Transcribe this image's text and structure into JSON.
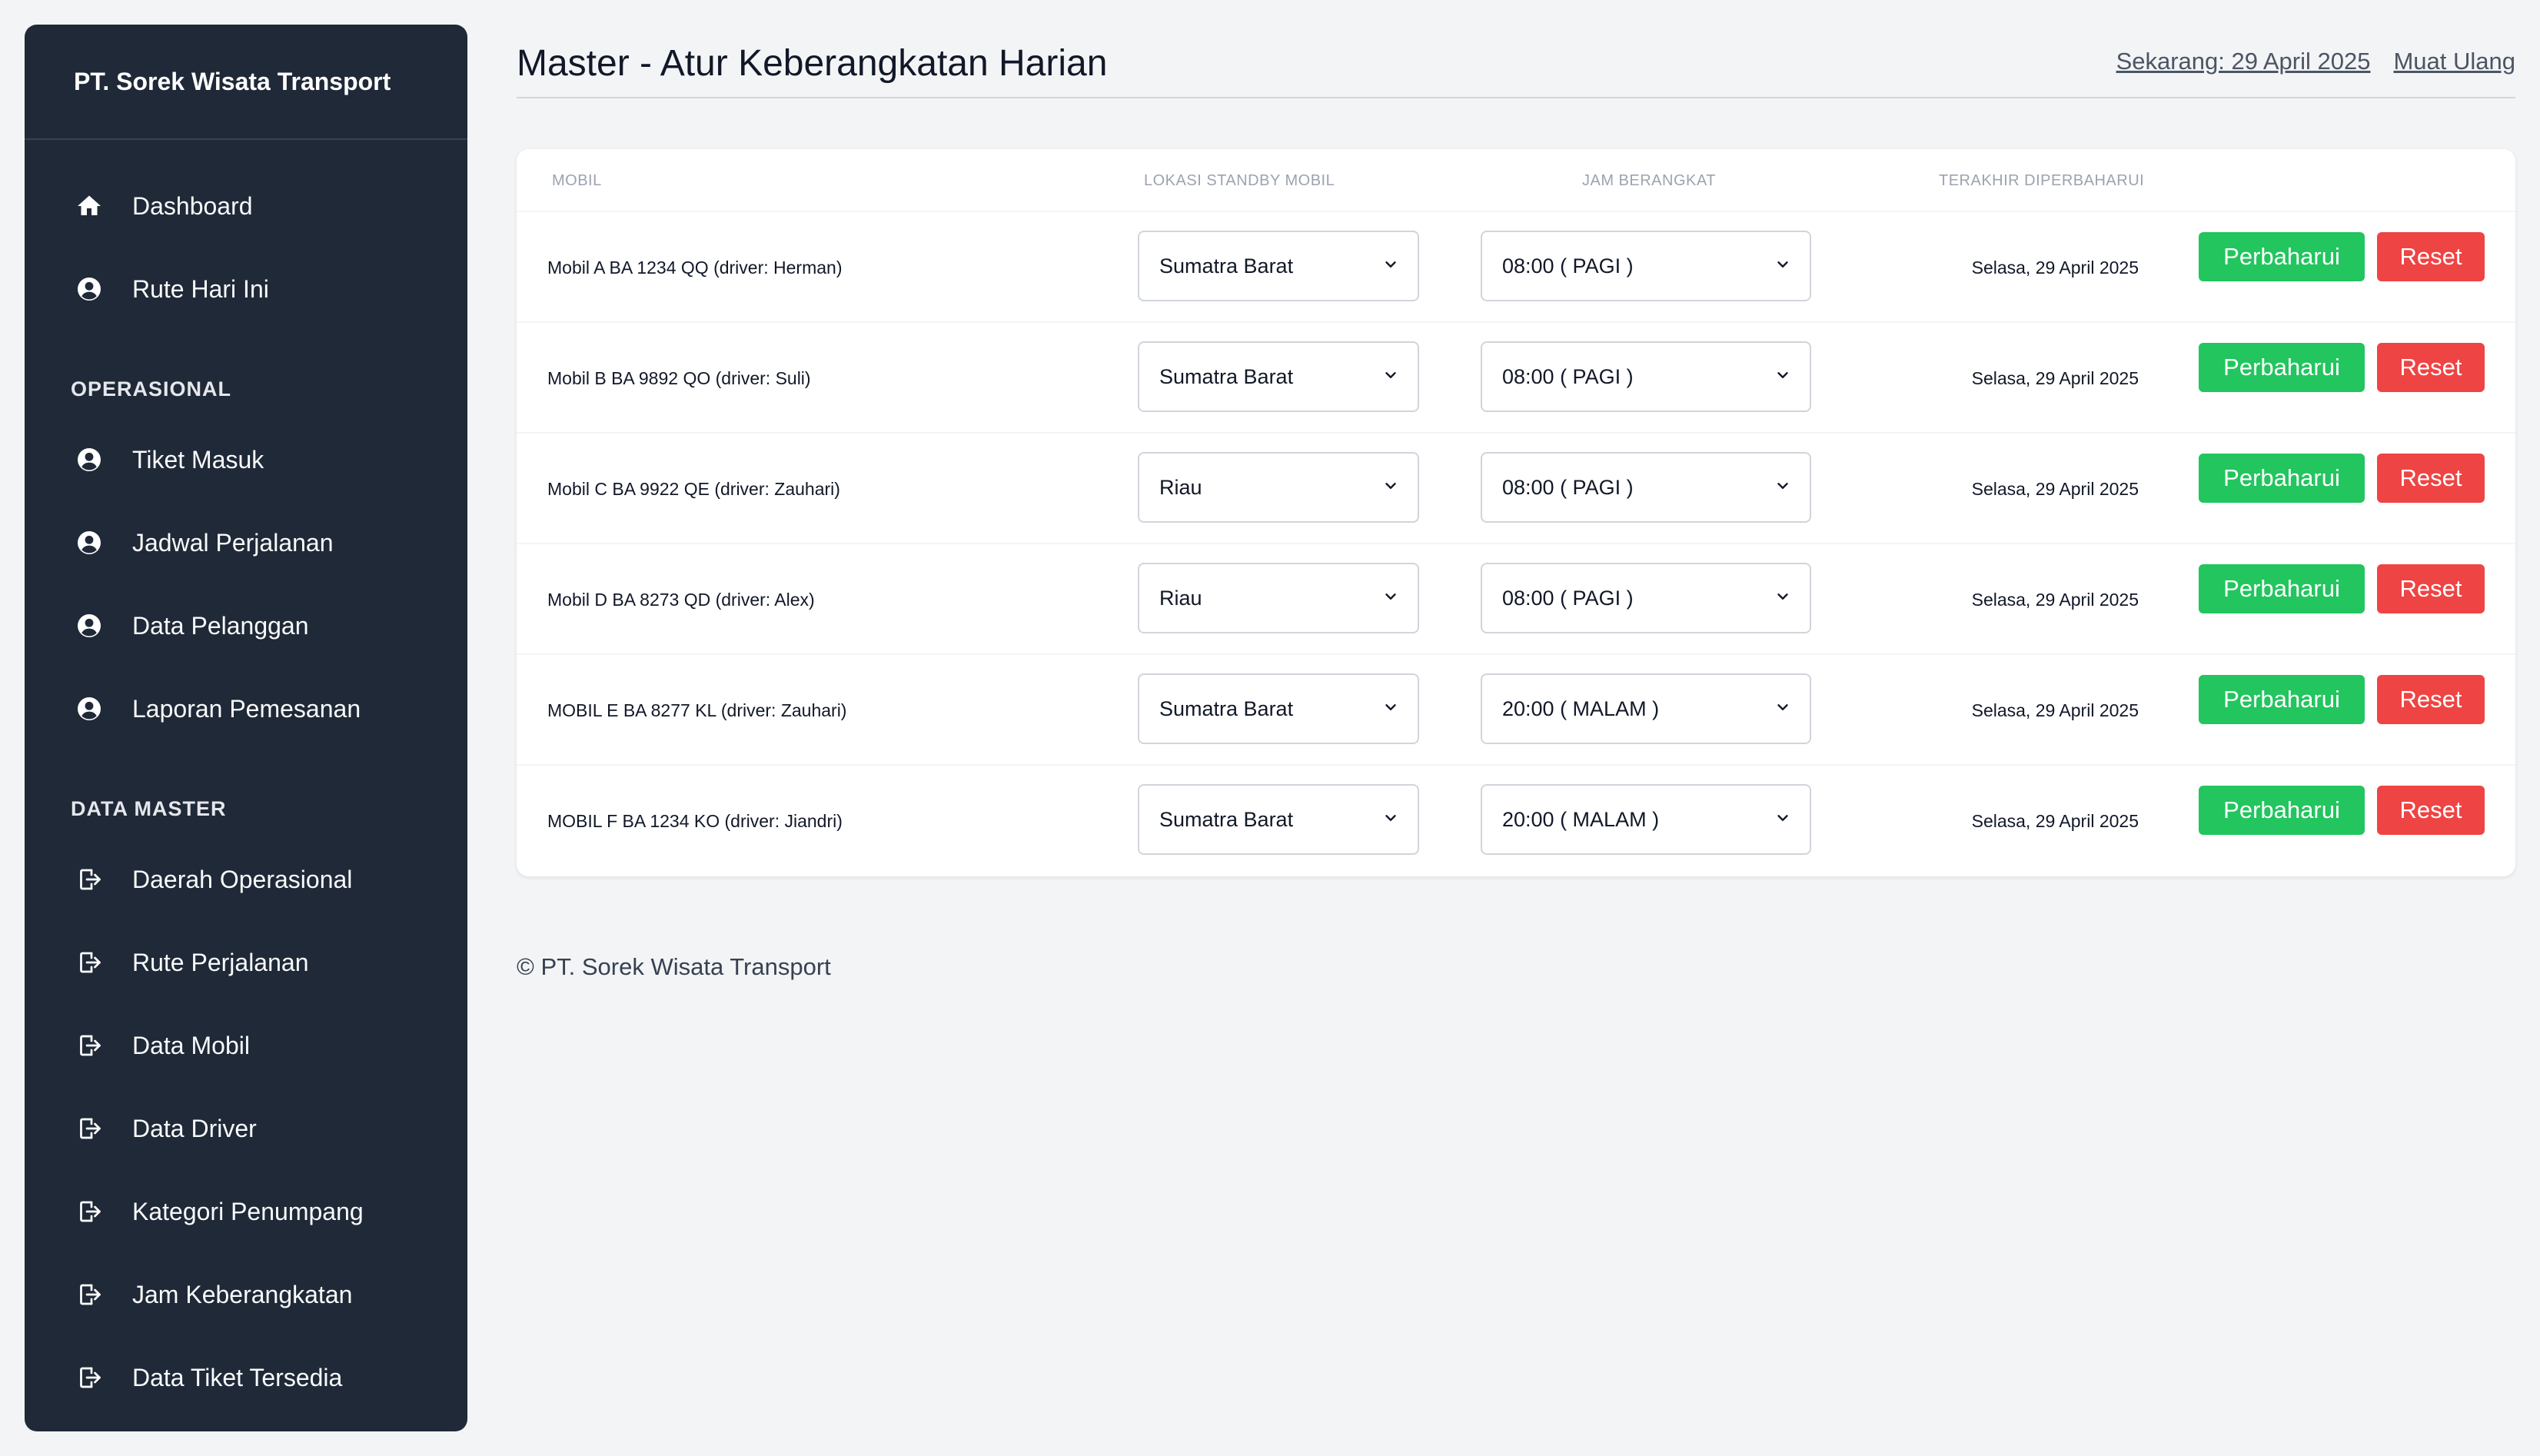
{
  "sidebar": {
    "brand": "PT. Sorek Wisata Transport",
    "top_items": [
      {
        "label": "Dashboard",
        "icon": "home-icon"
      },
      {
        "label": "Rute Hari Ini",
        "icon": "user-circle-icon"
      }
    ],
    "sections": [
      {
        "title": "OPERASIONAL",
        "items": [
          {
            "label": "Tiket Masuk",
            "icon": "user-circle-icon"
          },
          {
            "label": "Jadwal Perjalanan",
            "icon": "user-circle-icon"
          },
          {
            "label": "Data Pelanggan",
            "icon": "user-circle-icon"
          },
          {
            "label": "Laporan Pemesanan",
            "icon": "user-circle-icon"
          }
        ]
      },
      {
        "title": "DATA MASTER",
        "items": [
          {
            "label": "Daerah Operasional",
            "icon": "sign-out-icon"
          },
          {
            "label": "Rute Perjalanan",
            "icon": "sign-out-icon"
          },
          {
            "label": "Data Mobil",
            "icon": "sign-out-icon"
          },
          {
            "label": "Data Driver",
            "icon": "sign-out-icon"
          },
          {
            "label": "Kategori Penumpang",
            "icon": "sign-out-icon"
          },
          {
            "label": "Jam Keberangkatan",
            "icon": "sign-out-icon"
          },
          {
            "label": "Data Tiket Tersedia",
            "icon": "sign-out-icon"
          }
        ]
      }
    ]
  },
  "header": {
    "title": "Master - Atur Keberangkatan Harian",
    "now_label": "Sekarang: 29 April 2025",
    "reload_label": "Muat Ulang"
  },
  "table": {
    "columns": {
      "car": "MOBIL",
      "location": "LOKASI STANDBY MOBIL",
      "time": "JAM BERANGKAT",
      "updated": "TERAKHIR DIPERBAHARUI"
    },
    "update_label": "Perbaharui",
    "reset_label": "Reset",
    "rows": [
      {
        "car": "Mobil A BA 1234 QQ (driver: Herman)",
        "location": "Sumatra Barat",
        "time": "08:00 ( PAGI )",
        "updated": "Selasa, 29 April 2025"
      },
      {
        "car": "Mobil B BA 9892 QO (driver: Suli)",
        "location": "Sumatra Barat",
        "time": "08:00 ( PAGI )",
        "updated": "Selasa, 29 April 2025"
      },
      {
        "car": "Mobil C BA 9922 QE (driver: Zauhari)",
        "location": "Riau",
        "time": "08:00 ( PAGI )",
        "updated": "Selasa, 29 April 2025"
      },
      {
        "car": "Mobil D BA 8273 QD (driver: Alex)",
        "location": "Riau",
        "time": "08:00 ( PAGI )",
        "updated": "Selasa, 29 April 2025"
      },
      {
        "car": "MOBIL E BA 8277 KL (driver: Zauhari)",
        "location": "Sumatra Barat",
        "time": "20:00 ( MALAM )",
        "updated": "Selasa, 29 April 2025"
      },
      {
        "car": "MOBIL F BA 1234 KO (driver: Jiandri)",
        "location": "Sumatra Barat",
        "time": "20:00 ( MALAM )",
        "updated": "Selasa, 29 April 2025"
      }
    ]
  },
  "footer": "© PT. Sorek Wisata Transport",
  "colors": {
    "sidebar_bg": "#1f2937",
    "update_button": "#22c55e",
    "reset_button": "#ef4444"
  }
}
